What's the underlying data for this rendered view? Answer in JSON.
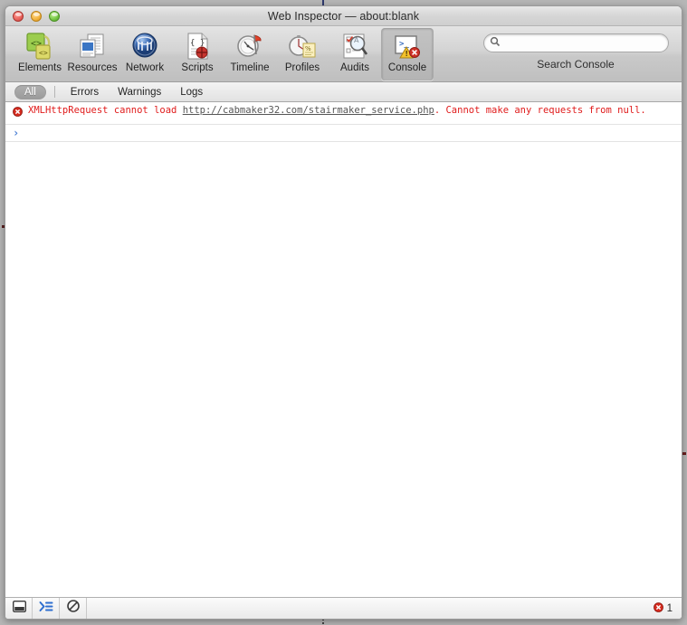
{
  "window": {
    "title": "Web Inspector — about:blank",
    "controls": {
      "close": "close-button",
      "minimize": "minimize-button",
      "zoom": "zoom-button"
    }
  },
  "toolbar": {
    "panels": [
      {
        "label": "Elements",
        "icon": "elements-icon",
        "selected": false
      },
      {
        "label": "Resources",
        "icon": "resources-icon",
        "selected": false
      },
      {
        "label": "Network",
        "icon": "network-icon",
        "selected": false
      },
      {
        "label": "Scripts",
        "icon": "scripts-icon",
        "selected": false
      },
      {
        "label": "Timeline",
        "icon": "timeline-icon",
        "selected": false
      },
      {
        "label": "Profiles",
        "icon": "profiles-icon",
        "selected": false
      },
      {
        "label": "Audits",
        "icon": "audits-icon",
        "selected": false
      },
      {
        "label": "Console",
        "icon": "console-icon",
        "selected": true
      }
    ],
    "search": {
      "value": "",
      "placeholder": "",
      "caption": "Search Console",
      "icon": "search-icon"
    }
  },
  "filterbar": {
    "items": [
      {
        "label": "All",
        "active": true
      },
      {
        "label": "Errors",
        "active": false
      },
      {
        "label": "Warnings",
        "active": false
      },
      {
        "label": "Logs",
        "active": false
      }
    ]
  },
  "console": {
    "messages": [
      {
        "level": "error",
        "icon": "error-icon",
        "text_before": "XMLHttpRequest cannot load ",
        "link": "http://cabmaker32.com/stairmaker_service.php",
        "text_after": ". Cannot make any requests from null."
      }
    ],
    "prompt": {
      "caret": "›",
      "value": "",
      "placeholder": ""
    }
  },
  "statusbar": {
    "buttons": [
      {
        "name": "dock-to-bottom-button",
        "icon": "dock-window-icon"
      },
      {
        "name": "execution-context-button",
        "icon": "prompt-chevron-list-icon"
      },
      {
        "name": "clear-console-button",
        "icon": "no-entry-icon"
      }
    ],
    "error_count": "1",
    "error_icon": "error-badge-icon"
  },
  "colors": {
    "error_text": "#e01b1b",
    "link": "#555555",
    "prompt_caret": "#4a7fd4",
    "selected_tab_bg": "#b8b8b8"
  }
}
